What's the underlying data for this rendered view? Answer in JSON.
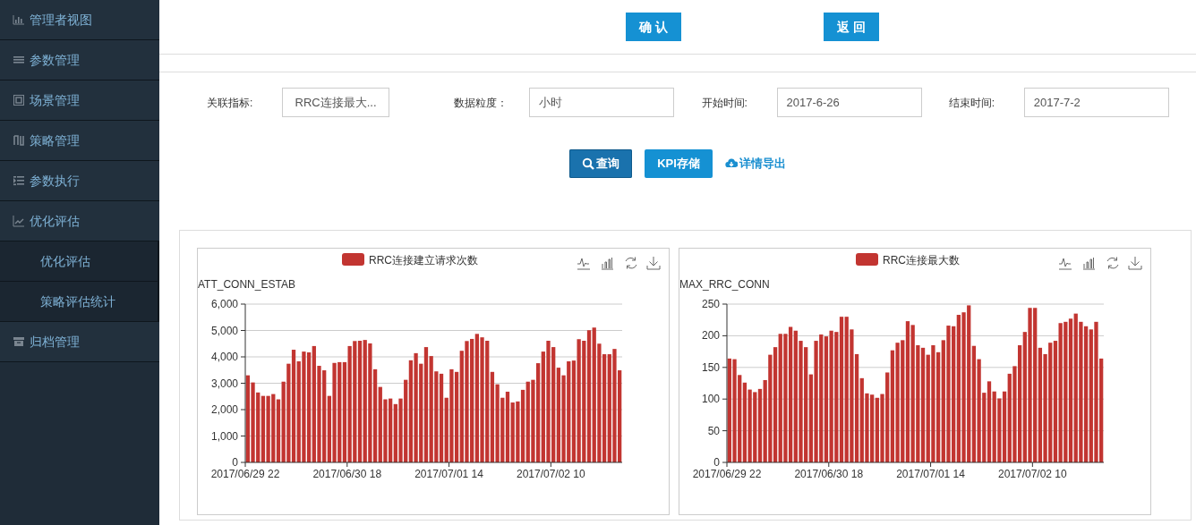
{
  "sidebar": {
    "items": [
      {
        "label": "管理者视图"
      },
      {
        "label": "参数管理"
      },
      {
        "label": "场景管理"
      },
      {
        "label": "策略管理"
      },
      {
        "label": "参数执行"
      },
      {
        "label": "优化评估",
        "expanded": true,
        "children": [
          {
            "label": "优化评估"
          },
          {
            "label": "策略评估统计"
          }
        ]
      },
      {
        "label": "归档管理"
      }
    ]
  },
  "top_buttons": [
    "确 认",
    "返 回"
  ],
  "filters": [
    {
      "label": "关联指标:",
      "kind": "select",
      "value": "RRC连接最大..."
    },
    {
      "label": "数据粒度：",
      "kind": "input",
      "value": "小时"
    },
    {
      "label": "开始时间:",
      "kind": "input",
      "value": "2017-6-26"
    },
    {
      "label": "结束时间:",
      "kind": "input",
      "value": "2017-7-2"
    }
  ],
  "actions": [
    {
      "label": "查询",
      "kind": "search",
      "active": true
    },
    {
      "label": "KPI存储",
      "kind": "save",
      "active": false
    },
    {
      "label": "详情导出",
      "kind": "export"
    }
  ],
  "charts": [
    {
      "chart_data": {
        "type": "bar",
        "ylabel": "ATT_CONN_ESTAB",
        "series": [
          {
            "name": "RRC连接建立请求次数",
            "color": "#c23531",
            "values": [
              3300,
              3030,
              2650,
              2520,
              2520,
              2590,
              2390,
              3060,
              3740,
              4270,
              3830,
              4200,
              4170,
              4410,
              3660,
              3490,
              2520,
              3770,
              3800,
              3800,
              4410,
              4600,
              4610,
              4640,
              4510,
              3530,
              2860,
              2390,
              2420,
              2210,
              2420,
              3130,
              3870,
              4140,
              3740,
              4370,
              4030,
              3450,
              3360,
              2450,
              3530,
              3430,
              4230,
              4600,
              4680,
              4870,
              4740,
              4610,
              3430,
              2960,
              2450,
              2680,
              2270,
              2310,
              2750,
              3060,
              3130,
              3760,
              4200,
              4610,
              4370,
              3590,
              3300,
              3830,
              3860,
              4670,
              4610,
              5010,
              5110,
              4500,
              4100,
              4100,
              4300,
              3490
            ]
          }
        ],
        "ylim": [
          0,
          6000
        ],
        "yticks": [
          {
            "value": 0,
            "label": "0"
          },
          {
            "value": 1000,
            "label": "1,000"
          },
          {
            "value": 2000,
            "label": "2,000"
          },
          {
            "value": 3000,
            "label": "3,000"
          },
          {
            "value": 4000,
            "label": "4,000"
          },
          {
            "value": 5000,
            "label": "5,000"
          },
          {
            "value": 6000,
            "label": "6,000"
          }
        ],
        "grid": true,
        "categories": [
          "2017/06/29 22",
          null,
          null,
          null,
          null,
          null,
          null,
          null,
          null,
          null,
          null,
          null,
          null,
          null,
          null,
          null,
          null,
          null,
          null,
          null,
          "2017/06/30 18",
          null,
          null,
          null,
          null,
          null,
          null,
          null,
          null,
          null,
          null,
          null,
          null,
          null,
          null,
          null,
          null,
          null,
          null,
          null,
          "2017/07/01 14",
          null,
          null,
          null,
          null,
          null,
          null,
          null,
          null,
          null,
          null,
          null,
          null,
          null,
          null,
          null,
          null,
          null,
          null,
          null,
          "2017/07/02 10",
          null,
          null,
          null,
          null,
          null,
          null,
          null,
          null,
          null,
          null,
          null,
          null,
          null
        ]
      }
    },
    {
      "chart_data": {
        "type": "bar",
        "ylabel": "MAX_RRC_CONN",
        "series": [
          {
            "name": "RRC连接最大数",
            "color": "#c23531",
            "values": [
              164,
              163,
              138,
              126,
              115,
              111,
              116,
              130,
              170,
              182,
              203,
              203,
              214,
              208,
              192,
              182,
              139,
              192,
              202,
              199,
              208,
              206,
              230,
              230,
              210,
              171,
              133,
              109,
              107,
              102,
              108,
              142,
              177,
              189,
              193,
              223,
              217,
              185,
              181,
              170,
              185,
              174,
              193,
              216,
              215,
              233,
              237,
              248,
              184,
              163,
              110,
              128,
              112,
              101,
              112,
              140,
              152,
              185,
              206,
              244,
              244,
              181,
              171,
              189,
              192,
              220,
              222,
              227,
              235,
              222,
              215,
              210,
              222,
              164
            ]
          }
        ],
        "ylim": [
          0,
          250
        ],
        "yticks": [
          0,
          50,
          100,
          150,
          200,
          250
        ],
        "grid": true,
        "categories": [
          "2017/06/29 22",
          null,
          null,
          null,
          null,
          null,
          null,
          null,
          null,
          null,
          null,
          null,
          null,
          null,
          null,
          null,
          null,
          null,
          null,
          null,
          "2017/06/30 18",
          null,
          null,
          null,
          null,
          null,
          null,
          null,
          null,
          null,
          null,
          null,
          null,
          null,
          null,
          null,
          null,
          null,
          null,
          null,
          "2017/07/01 14",
          null,
          null,
          null,
          null,
          null,
          null,
          null,
          null,
          null,
          null,
          null,
          null,
          null,
          null,
          null,
          null,
          null,
          null,
          null,
          "2017/07/02 10",
          null,
          null,
          null,
          null,
          null,
          null,
          null,
          null,
          null,
          null,
          null,
          null,
          null
        ]
      }
    }
  ]
}
